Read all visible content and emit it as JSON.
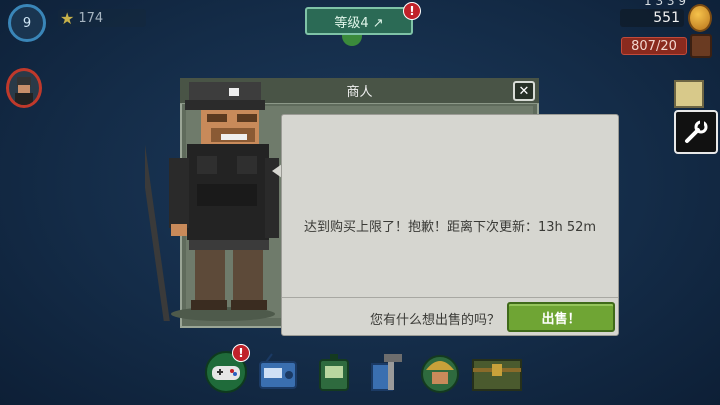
{
  "hud": {
    "player_level": "9",
    "stars": "174",
    "level_button_label": "等级4 ↗",
    "level_alert": "!",
    "coins_partial": "1 3 3 9",
    "coins": "551",
    "capacity": "807/20"
  },
  "merchant": {
    "title": "商人",
    "close_label": "✕",
    "message": "达到购买上限了！抱歉！距离下次更新：13h 52m",
    "question": "您有什么想出售的吗？",
    "sell_button_label": "出售！"
  },
  "dock": {
    "gamepad_alert": "!",
    "icons": [
      "gamepad-icon",
      "radio-icon",
      "device-icon",
      "tools-icon",
      "soldier-icon",
      "crate-icon"
    ]
  },
  "colors": {
    "background": "#142c48",
    "panel": "#5f6b5c",
    "bubble": "#d6d6d0",
    "sell_button": "#6fa534",
    "alert": "#c0222a"
  }
}
